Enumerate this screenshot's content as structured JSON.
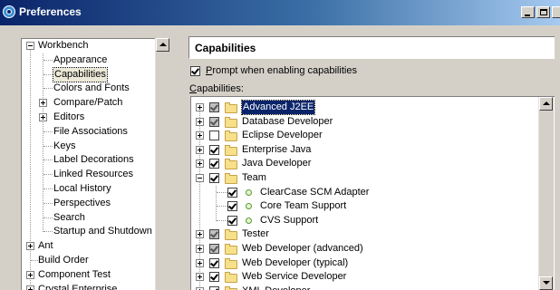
{
  "window": {
    "title": "Preferences"
  },
  "left_tree": {
    "items": [
      {
        "label": "Workbench",
        "level": 0,
        "expander": "minus"
      },
      {
        "label": "Appearance",
        "level": 1
      },
      {
        "label": "Capabilities",
        "level": 1,
        "selected": true
      },
      {
        "label": "Colors and Fonts",
        "level": 1
      },
      {
        "label": "Compare/Patch",
        "level": 1,
        "expander": "plus"
      },
      {
        "label": "Editors",
        "level": 1,
        "expander": "plus"
      },
      {
        "label": "File Associations",
        "level": 1
      },
      {
        "label": "Keys",
        "level": 1
      },
      {
        "label": "Label Decorations",
        "level": 1
      },
      {
        "label": "Linked Resources",
        "level": 1
      },
      {
        "label": "Local History",
        "level": 1
      },
      {
        "label": "Perspectives",
        "level": 1
      },
      {
        "label": "Search",
        "level": 1
      },
      {
        "label": "Startup and Shutdown",
        "level": 1
      },
      {
        "label": "Ant",
        "level": 0,
        "expander": "plus"
      },
      {
        "label": "Build Order",
        "level": 0
      },
      {
        "label": "Component Test",
        "level": 0,
        "expander": "plus"
      },
      {
        "label": "Crystal Enterprise",
        "level": 0,
        "expander": "plus"
      }
    ]
  },
  "right_panel": {
    "title": "Capabilities",
    "prompt_checkbox": {
      "label": "Prompt when enabling capabilities",
      "checked": true
    },
    "capabilities_label": "Capabilities:"
  },
  "capabilities": [
    {
      "label": "Advanced J2EE",
      "level": 0,
      "check": "grayed",
      "expander": "plus",
      "selected": true
    },
    {
      "label": "Database Developer",
      "level": 0,
      "check": "grayed",
      "expander": "plus"
    },
    {
      "label": "Eclipse Developer",
      "level": 0,
      "check": "unchecked",
      "expander": "plus"
    },
    {
      "label": "Enterprise Java",
      "level": 0,
      "check": "checked",
      "expander": "plus"
    },
    {
      "label": "Java Developer",
      "level": 0,
      "check": "checked",
      "expander": "plus"
    },
    {
      "label": "Team",
      "level": 0,
      "check": "checked",
      "expander": "minus"
    },
    {
      "label": "ClearCase SCM Adapter",
      "level": 1,
      "check": "checked"
    },
    {
      "label": "Core Team Support",
      "level": 1,
      "check": "checked"
    },
    {
      "label": "CVS Support",
      "level": 1,
      "check": "checked"
    },
    {
      "label": "Tester",
      "level": 0,
      "check": "grayed",
      "expander": "plus"
    },
    {
      "label": "Web Developer (advanced)",
      "level": 0,
      "check": "grayed",
      "expander": "plus"
    },
    {
      "label": "Web Developer (typical)",
      "level": 0,
      "check": "checked",
      "expander": "plus"
    },
    {
      "label": "Web Service Developer",
      "level": 0,
      "check": "checked",
      "expander": "plus"
    },
    {
      "label": "XML Developer",
      "level": 0,
      "check": "checked",
      "expander": "plus"
    }
  ]
}
